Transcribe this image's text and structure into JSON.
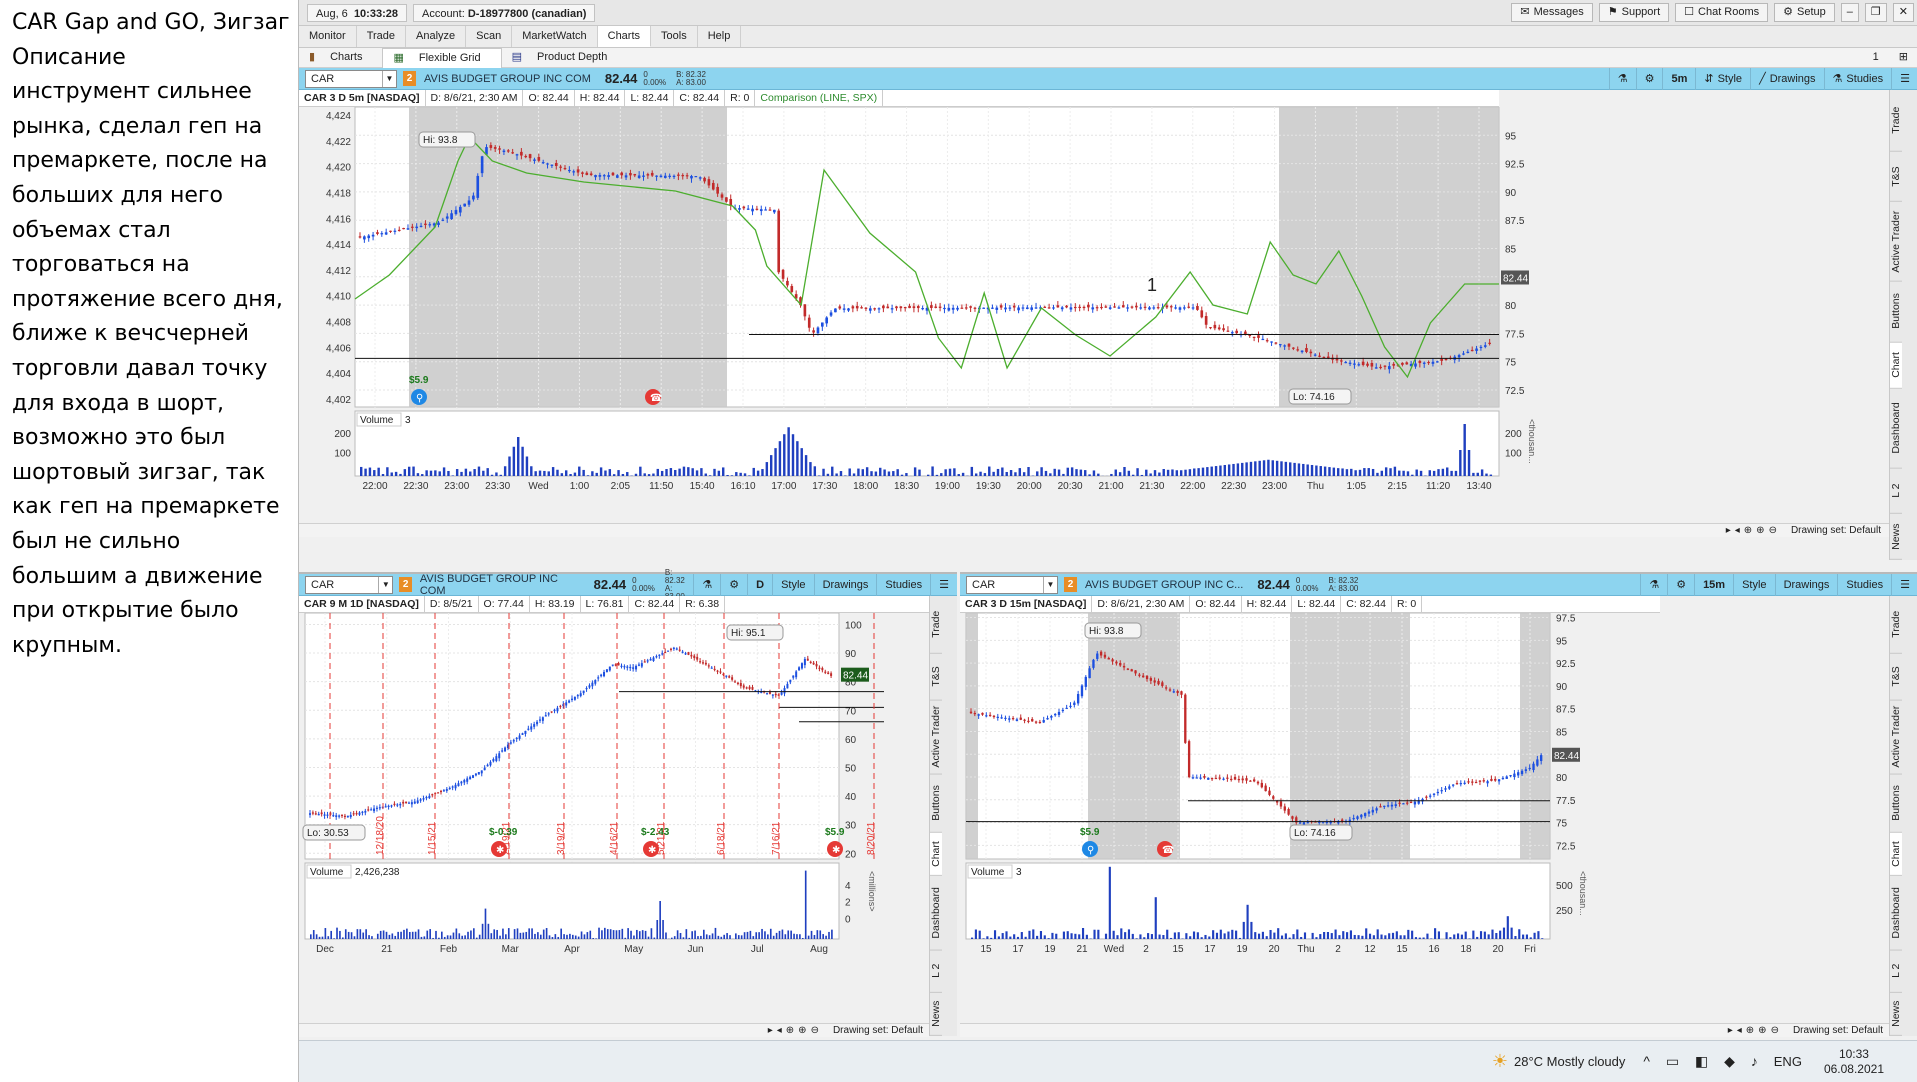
{
  "note": {
    "title": "CAR Gap and GO, Зигзаг",
    "body": "Описание\nинструмент сильнее\nрынка,  сделал геп на\nпремаркете, после на\nбольших для него\nобъемах стал\nторговаться на\nпротяжение всего дня,\nближе к вечсчерней\nторговли давал точку\nдля входа в шорт,\nвозможно это был\nшортовый зигзаг, так\nкак геп на премаркете\nбыл не сильно\nбольшим а движение\nпри открытие было\nкрупным."
  },
  "topbar": {
    "date": "Aug, 6",
    "time": "10:33:28",
    "account_label": "Account:",
    "account": "D-18977800 (canadian)",
    "messages": "Messages",
    "support": "Support",
    "chat_rooms": "Chat Rooms",
    "setup": "Setup"
  },
  "menu": [
    "Monitor",
    "Trade",
    "Analyze",
    "Scan",
    "MarketWatch",
    "Charts",
    "Tools",
    "Help"
  ],
  "subtabs": [
    "Charts",
    "Flexible Grid",
    "Product Depth"
  ],
  "grid_count": "1",
  "tools": {
    "style": "Style",
    "drawings": "Drawings",
    "studies": "Studies",
    "drawing_set": "Drawing set: Default"
  },
  "symbol": {
    "ticker": "CAR",
    "name": "AVIS BUDGET GROUP INC COM",
    "name_short": "AVIS BUDGET GROUP INC C...",
    "price": "82.44",
    "chg_top": "0",
    "chg_bot": "0.00%",
    "bid": "B: 82.32",
    "ask": "A: 83.00",
    "badge": "2"
  },
  "colors": {
    "up": "#1c4fe0",
    "down": "#c22a2a",
    "flat": "#2a6ff2",
    "price_line": "#4cae2e",
    "session": "#c8c8c8",
    "tag": "#1c7a1c",
    "event": "#1e88e5",
    "earn": "#e53935"
  },
  "vtabs": [
    "Trade",
    "T&S",
    "Active Trader",
    "Buttons",
    "Chart",
    "Dashboard",
    "L 2",
    "News"
  ],
  "charts": {
    "main": {
      "interval": "5m",
      "info": [
        "CAR 3 D 5m [NASDAQ]",
        "D: 8/6/21, 2:30 AM",
        "O: 82.44",
        "H: 82.44",
        "L: 82.44",
        "C: 82.44",
        "R: 0",
        "Comparison (LINE, SPX)"
      ],
      "left_ticks": [
        "4,424",
        "4,422",
        "4,420",
        "4,418",
        "4,416",
        "4,414",
        "4,412",
        "4,410",
        "4,408",
        "4,406",
        "4,404",
        "4,402"
      ],
      "right_ticks": [
        "95",
        "92.5",
        "90",
        "87.5",
        "85",
        "82.5",
        "80",
        "77.5",
        "75",
        "72.5"
      ],
      "x_ticks": [
        "22:00",
        "22:30",
        "23:00",
        "23:30",
        "Wed",
        "1:00",
        "2:05",
        "11:50",
        "15:40",
        "16:10",
        "17:00",
        "17:30",
        "18:00",
        "18:30",
        "19:00",
        "19:30",
        "20:00",
        "20:30",
        "21:00",
        "21:30",
        "22:00",
        "22:30",
        "23:00",
        "Thu",
        "1:05",
        "2:15",
        "11:20",
        "13:40"
      ],
      "hi": "Hi: 93.8",
      "lo": "Lo: 74.16",
      "event": "$5.9",
      "price_tag": "82.44",
      "mark": "1",
      "volume": "Volume",
      "vol_count": "3",
      "vol_ticks": [
        "200",
        "100"
      ],
      "vol_unit": "<thousan..."
    },
    "bl": {
      "interval": "D",
      "info": [
        "CAR 9 M 1D [NASDAQ]",
        "D: 8/5/21",
        "O: 77.44",
        "H: 83.19",
        "L: 76.81",
        "C: 82.44",
        "R: 6.38"
      ],
      "right_ticks": [
        "100",
        "90",
        "80",
        "70",
        "60",
        "50",
        "40",
        "30",
        "20"
      ],
      "x_ticks": [
        "Dec",
        "21",
        "Feb",
        "Mar",
        "Apr",
        "May",
        "Jun",
        "Jul",
        "Aug"
      ],
      "expiry": [
        "12/18/20",
        "1/15/21",
        "2/19/21",
        "3/19/21",
        "4/16/21",
        "5/21/21",
        "6/18/21",
        "7/16/21",
        "8/20/21"
      ],
      "ev": [
        "$-0.39",
        "$-2.43",
        "$5.9"
      ],
      "hi": "Hi: 95.1",
      "lo": "Lo: 30.53",
      "price_tag": "82.44",
      "volume": "Volume",
      "vol_count": "2,426,238",
      "vol_ticks": [
        "4",
        "2",
        "0"
      ],
      "vol_unit": "<millions>"
    },
    "br": {
      "interval": "15m",
      "info": [
        "CAR 3 D 15m [NASDAQ]",
        "D: 8/6/21, 2:30 AM",
        "O: 82.44",
        "H: 82.44",
        "L: 82.44",
        "C: 82.44",
        "R: 0"
      ],
      "right_ticks": [
        "97.5",
        "95",
        "92.5",
        "90",
        "87.5",
        "85",
        "82.5",
        "80",
        "77.5",
        "75",
        "72.5"
      ],
      "x_ticks": [
        "15",
        "17",
        "19",
        "21",
        "Wed",
        "2",
        "15",
        "17",
        "19",
        "20",
        "Thu",
        "2",
        "12",
        "15",
        "16",
        "18",
        "20",
        "Fri"
      ],
      "hi": "Hi: 93.8",
      "lo": "Lo: 74.16",
      "event": "$5.9",
      "price_tag": "82.44",
      "volume": "Volume",
      "vol_count": "3",
      "vol_ticks": [
        "500",
        "250"
      ],
      "vol_unit": "<thousan..."
    }
  },
  "taskbar": {
    "weather": "28°C  Mostly cloudy",
    "lang": "ENG",
    "time": "10:33",
    "date": "06.08.2021"
  }
}
